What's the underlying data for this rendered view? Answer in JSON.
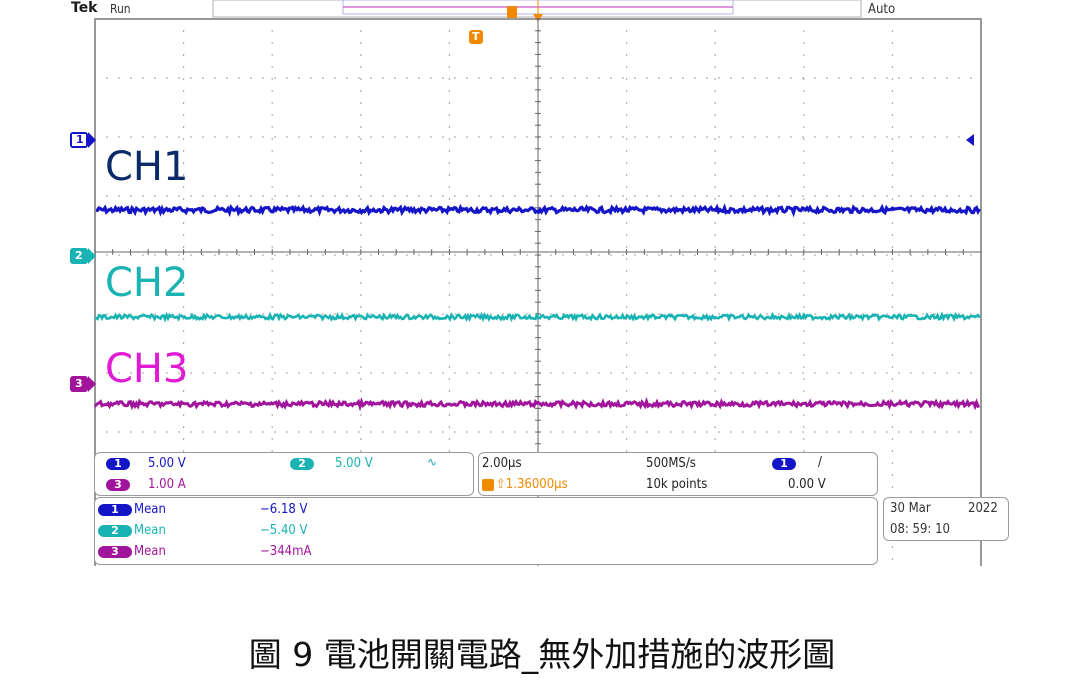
{
  "header": {
    "brand": "Tek",
    "status": "Run",
    "trigger_mode": "Auto"
  },
  "trace_labels": {
    "ch1": "CH1",
    "ch2": "CH2",
    "ch3": "CH3"
  },
  "markers": {
    "ch1": "1",
    "ch2": "2",
    "ch3": "3",
    "trigger": "T"
  },
  "colors": {
    "ch1": "#1515c8",
    "ch1_label": "#0a2a6a",
    "ch2": "#19b3b3",
    "ch3": "#a0159b",
    "ch3_label": "#e01ad5",
    "trigger": "#f08a00",
    "grid": "#7a7a7a"
  },
  "channel_settings": {
    "ch1_scale": "5.00 V",
    "ch2_scale": "5.00 V",
    "ch3_scale": "1.00 A",
    "ch2_bw_icon": "bandwidth-limit-icon",
    "time_per_div": "2.00μs",
    "trigger_position": "⇧1.36000μs",
    "sample_rate": "500MS/s",
    "record_length": "10k points",
    "trigger_channel": "1",
    "trigger_slope": "/",
    "trigger_level": "0.00 V"
  },
  "measurements": [
    {
      "channel": "1",
      "name": "Mean",
      "value": "−6.18 V"
    },
    {
      "channel": "2",
      "name": "Mean",
      "value": "−5.40 V"
    },
    {
      "channel": "3",
      "name": "Mean",
      "value": "−344mA"
    }
  ],
  "datetime": {
    "date": "30 Mar",
    "year": "2022",
    "time": "08: 59: 10"
  },
  "caption": "圖 9 電池開關電路_無外加措施的波形圖"
}
